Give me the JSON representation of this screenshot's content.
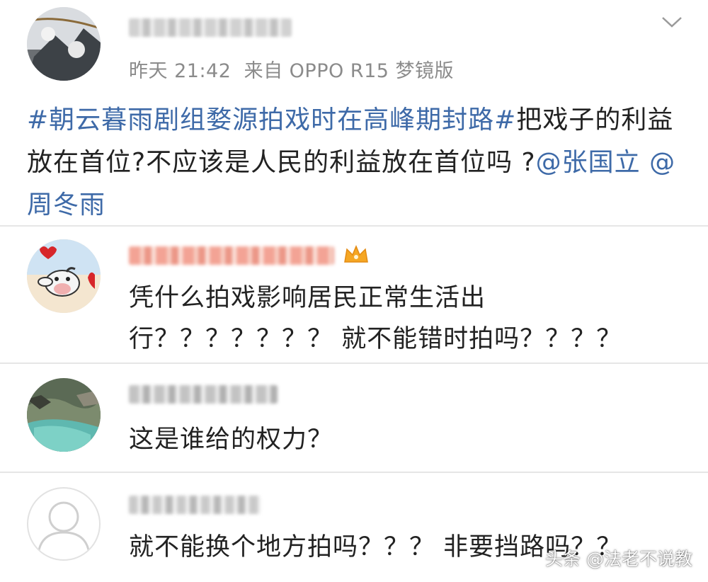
{
  "post": {
    "author_avatar": "avatar-photo",
    "author_name_blurred": true,
    "time": "昨天 21:42",
    "source": "来自 OPPO R15 梦镜版",
    "topic": "#朝云暮雨剧组婺源拍戏时在高峰期封路#",
    "text": "把戏子的利益放在首位?不应该是人民的利益放在首位吗 ?",
    "mentions": [
      "@张国立",
      "@周冬雨"
    ],
    "menu_icon": "chevron-down-icon"
  },
  "comments": [
    {
      "text": "凭什么拍戏影响居民正常生活出行？？？？？？？ 就不能错时拍吗？？？？",
      "badge_icon": "crown-icon"
    },
    {
      "text": "这是谁给的权力？"
    },
    {
      "text": "就不能换个地方拍吗？？？ 非要挡路吗？？"
    }
  ],
  "watermark": "头条 @法老不说教",
  "colors": {
    "link": "#3e6aa8",
    "meta": "#8b8b8b",
    "divider": "#e6e6e6"
  }
}
